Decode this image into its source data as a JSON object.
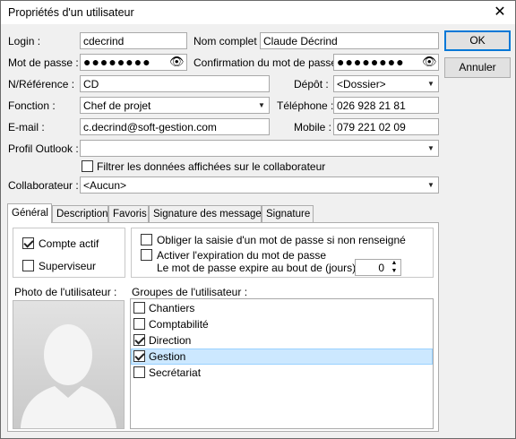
{
  "window": {
    "title": "Propriétés d'un utilisateur",
    "close_glyph": "✕"
  },
  "buttons": {
    "ok": "OK",
    "cancel": "Annuler"
  },
  "form": {
    "login_label": "Login :",
    "login_value": "cdecrind",
    "fullname_label": "Nom complet :",
    "fullname_value": "Claude Décrind",
    "password_label": "Mot de passe :",
    "password_value": "●●●●●●●●",
    "confirm_label": "Confirmation du mot de passe :",
    "confirm_value": "●●●●●●●●",
    "reference_label": "N/Référence :",
    "reference_value": "CD",
    "depot_label": "Dépôt :",
    "depot_value": "<Dossier>",
    "fonction_label": "Fonction :",
    "fonction_value": "Chef de projet",
    "telephone_label": "Téléphone :",
    "telephone_value": "026 928 21 81",
    "email_label": "E-mail :",
    "email_value": "c.decrind@soft-gestion.com",
    "mobile_label": "Mobile :",
    "mobile_value": "079 221 02 09",
    "outlook_label": "Profil Outlook :",
    "outlook_value": "",
    "filter_label": "Filtrer les données affichées sur le collaborateur",
    "collaborateur_label": "Collaborateur :",
    "collaborateur_value": "<Aucun>"
  },
  "tabs": [
    "Général",
    "Description",
    "Favoris",
    "Signature des messages",
    "Signature"
  ],
  "general": {
    "compte_actif": "Compte actif",
    "superviseur": "Superviseur",
    "obliger": "Obliger la saisie d'un mot de passe si non renseigné",
    "activer": "Activer l'expiration du mot de passe",
    "expire_label": "Le mot de passe expire au bout de (jours) :",
    "expire_days": "0",
    "photo_label": "Photo de l'utilisateur :",
    "groups_label": "Groupes de l'utilisateur :",
    "groups": [
      {
        "name": "Chantiers",
        "checked": false
      },
      {
        "name": "Comptabilité",
        "checked": false
      },
      {
        "name": "Direction",
        "checked": true
      },
      {
        "name": "Gestion",
        "checked": true
      },
      {
        "name": "Secrétariat",
        "checked": false
      }
    ]
  },
  "icons": {
    "eye": "eye-icon",
    "dropdown": "chevron-down-icon"
  }
}
